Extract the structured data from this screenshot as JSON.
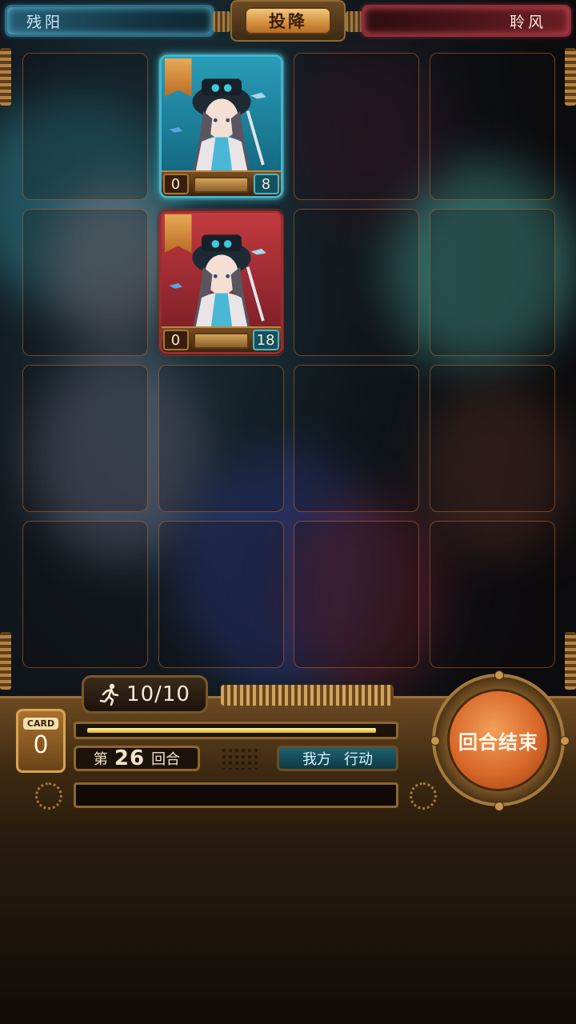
{
  "top_bar": {
    "player_left_name": "残阳",
    "player_right_name": "聆风",
    "surrender_label": "投降"
  },
  "board": {
    "rows": 4,
    "cols": 4,
    "cards": [
      {
        "row": 0,
        "col": 1,
        "side": "player",
        "frame_color": "blue",
        "attack": "0",
        "health": "8"
      },
      {
        "row": 1,
        "col": 1,
        "side": "enemy",
        "frame_color": "red",
        "attack": "0",
        "health": "18"
      }
    ]
  },
  "hud": {
    "moves_icon": "running-man-icon",
    "moves_text": "10/10",
    "card_label": "CARD",
    "card_count": "0",
    "turn_prefix": "第",
    "turn_number": "26",
    "turn_suffix": "回合",
    "phase_side": "我方",
    "phase_action": "行动",
    "progress_fraction": 0.97,
    "log_text": "",
    "end_turn_label": "回合结束"
  },
  "colors": {
    "player_blue": "#2fb2d4",
    "enemy_red": "#c23a3f",
    "brass": "#a57a3f",
    "end_turn_orange": "#d8692a"
  }
}
